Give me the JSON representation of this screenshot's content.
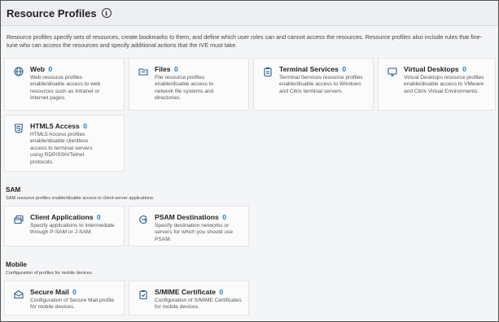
{
  "page": {
    "title": "Resource Profiles",
    "description": "Resource profiles specify sets of resources, create bookmarks to them, and define which user roles can and cannot access the resources. Resource profiles also include rules that fine-tune who can access the resources and specify additional actions that the IVE must take."
  },
  "profiles": [
    {
      "title": "Web",
      "count": "0",
      "desc": "Web resource profiles enable/disable access to web resources such as Intranet or Internet pages.",
      "icon": "globe-icon"
    },
    {
      "title": "Files",
      "count": "0",
      "desc": "File resource profiles enable/disable access to network file systems and directories.",
      "icon": "folder-icon"
    },
    {
      "title": "Terminal Services",
      "count": "0",
      "desc": "Terminal Services resource profiles enable/disable access to Windows and Citrix terminal servers.",
      "icon": "clipboard-icon"
    },
    {
      "title": "Virtual Desktops",
      "count": "0",
      "desc": "Virtual Desktops resource profiles enable/disable access to VMware and Citrix Virtual Environments.",
      "icon": "monitor-icon"
    },
    {
      "title": "HTML5 Access",
      "count": "0",
      "desc": "HTML5 Access profiles enable/disable clientless access to terminal servers using RDP/SSH/Telnet protocols.",
      "icon": "html5-icon"
    }
  ],
  "sam": {
    "title": "SAM",
    "description": "SAM resource profiles enable/disable access to client-server applications.",
    "items": [
      {
        "title": "Client Applications",
        "count": "0",
        "desc": "Specify applications to intermediate through P-SAM or J-SAM.",
        "icon": "windows-icon"
      },
      {
        "title": "PSAM Destinations",
        "count": "0",
        "desc": "Specify destination networks or servers for which you should use PSAM.",
        "icon": "arrow-circle-icon"
      }
    ]
  },
  "mobile": {
    "title": "Mobile",
    "description": "Configuration of profiles for mobile devices.",
    "items": [
      {
        "title": "Secure Mail",
        "count": "0",
        "desc": "Configuration of Secure Mail profile for mobile devices.",
        "icon": "mail-icon"
      },
      {
        "title": "S/MIME Certificate",
        "count": "0",
        "desc": "Configuration of S/MIME Certificates for mobile devices.",
        "icon": "certificate-icon"
      }
    ]
  },
  "colors": {
    "accent": "#1a7fbf",
    "icon": "#2a5b8a"
  }
}
